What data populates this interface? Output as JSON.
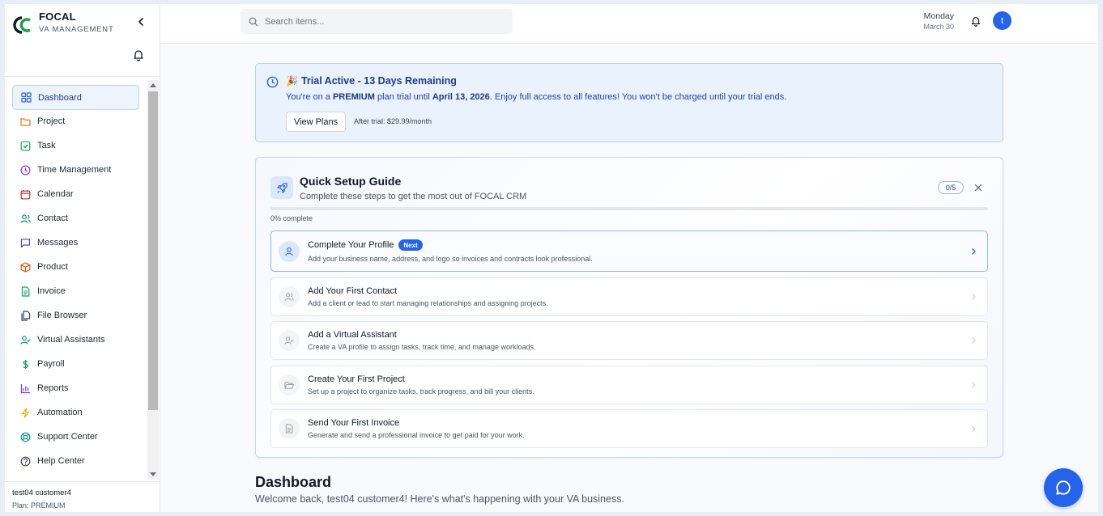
{
  "brand": {
    "name": "FOCAL",
    "subtitle": "VA MANAGEMENT"
  },
  "search": {
    "placeholder": "Search items..."
  },
  "header": {
    "day": "Monday",
    "date": "March 30",
    "avatar_initial": "t"
  },
  "sidebar": {
    "items": [
      {
        "label": "Dashboard",
        "icon": "grid-icon",
        "active": true
      },
      {
        "label": "Project",
        "icon": "folder-icon"
      },
      {
        "label": "Task",
        "icon": "checkbox-icon"
      },
      {
        "label": "Time Management",
        "icon": "clock-icon"
      },
      {
        "label": "Calendar",
        "icon": "calendar-icon"
      },
      {
        "label": "Contact",
        "icon": "users-icon"
      },
      {
        "label": "Messages",
        "icon": "message-icon"
      },
      {
        "label": "Product",
        "icon": "box-icon"
      },
      {
        "label": "Invoice",
        "icon": "invoice-icon"
      },
      {
        "label": "File Browser",
        "icon": "files-icon"
      },
      {
        "label": "Virtual Assistants",
        "icon": "user-check-icon"
      },
      {
        "label": "Payroll",
        "icon": "dollar-icon"
      },
      {
        "label": "Reports",
        "icon": "bar-chart-icon"
      },
      {
        "label": "Automation",
        "icon": "bolt-icon"
      },
      {
        "label": "Support Center",
        "icon": "lifebuoy-icon"
      },
      {
        "label": "Help Center",
        "icon": "help-icon"
      }
    ],
    "user_name": "test04 customer4",
    "plan": "Plan: PREMIUM"
  },
  "trial": {
    "title": "Trial Active - 13 Days Remaining",
    "msg_prefix": "You're on a ",
    "plan": "PREMIUM",
    "msg_mid": " plan trial until ",
    "end_date": "April 13, 2026",
    "msg_suffix": ". Enjoy full access to all features! You won't be charged until your trial ends.",
    "button": "View Plans",
    "after": "After trial: $29.99/month"
  },
  "guide": {
    "title": "Quick Setup Guide",
    "subtitle": "Complete these steps to get the most out of FOCAL CRM",
    "count": "0/5",
    "progress_label": "0% complete",
    "progress_fraction": 0,
    "next_badge": "Next",
    "steps": [
      {
        "title": "Complete Your Profile",
        "desc": "Add your business name, address, and logo so invoices and contracts look professional.",
        "icon": "user-icon"
      },
      {
        "title": "Add Your First Contact",
        "desc": "Add a client or lead to start managing relationships and assigning projects.",
        "icon": "users-icon"
      },
      {
        "title": "Add a Virtual Assistant",
        "desc": "Create a VA profile to assign tasks, track time, and manage workloads.",
        "icon": "user-check-icon"
      },
      {
        "title": "Create Your First Project",
        "desc": "Set up a project to organize tasks, track progress, and bill your clients.",
        "icon": "folder-open-icon"
      },
      {
        "title": "Send Your First Invoice",
        "desc": "Generate and send a professional invoice to get paid for your work.",
        "icon": "document-icon"
      }
    ]
  },
  "dashboard": {
    "title": "Dashboard",
    "welcome": "Welcome back, test04 customer4! Here's what's happening with your VA business."
  },
  "colors": {
    "accent": "#2563eb",
    "banner_bg": "#eaf2fd",
    "brand_green": "#16a34a"
  }
}
